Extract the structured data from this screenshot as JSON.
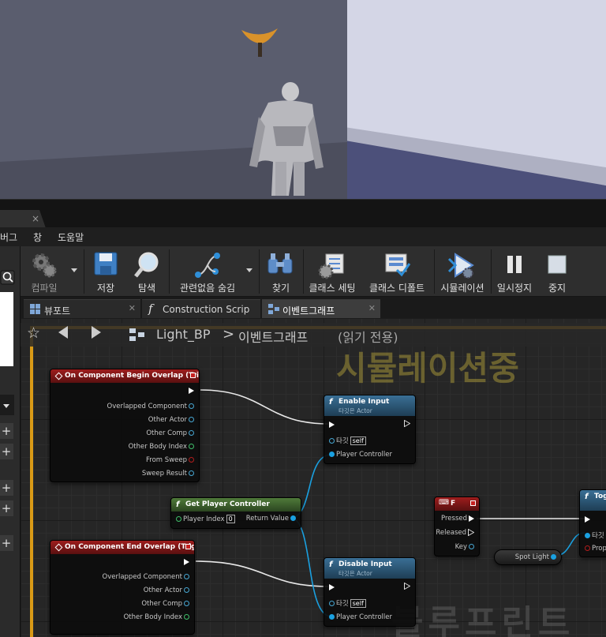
{
  "window": {
    "tab_close": "×"
  },
  "menu": [
    "버그",
    "창",
    "도움말"
  ],
  "toolbar": [
    {
      "label": "컴파일",
      "icon": "compile-icon"
    },
    {
      "label": "저장",
      "icon": "save-icon"
    },
    {
      "label": "탐색",
      "icon": "browse-icon"
    },
    {
      "label": "관련없음 숨김",
      "icon": "hide-unrelated-icon"
    },
    {
      "label": "찾기",
      "icon": "find-icon"
    },
    {
      "label": "클래스 세팅",
      "icon": "class-settings-icon"
    },
    {
      "label": "클래스 디폴트",
      "icon": "class-defaults-icon"
    },
    {
      "label": "시뮬레이션",
      "icon": "simulation-icon"
    },
    {
      "label": "일시정지",
      "icon": "pause-icon"
    },
    {
      "label": "중지",
      "icon": "stop-icon"
    }
  ],
  "tabs": [
    {
      "label": "뷰포트",
      "icon": "viewport-icon"
    },
    {
      "label": "Construction Scrip",
      "icon": "function-icon"
    },
    {
      "label": "이벤트그래프",
      "icon": "graph-icon"
    }
  ],
  "breadcrumb": {
    "blueprint": "Light_BP",
    "sep": ">",
    "graph": "이벤트그래프",
    "readonly": "(읽기 전용)"
  },
  "watermarks": {
    "simulating": "시뮬레이션중",
    "blueprint": "블루프린트"
  },
  "nodes": {
    "begin_overlap": {
      "title": "On Component Begin Overlap (Trigger)",
      "pins": [
        "Overlapped Component",
        "Other Actor",
        "Other Comp",
        "Other Body Index",
        "From Sweep",
        "Sweep Result"
      ]
    },
    "end_overlap": {
      "title": "On Component End Overlap (Trigger)",
      "pins": [
        "Overlapped Component",
        "Other Actor",
        "Other Comp",
        "Other Body Index"
      ]
    },
    "enable_input": {
      "title": "Enable Input",
      "subtitle": "타깃은 Actor",
      "target_label": "타깃",
      "target_value": "self",
      "pc_label": "Player Controller"
    },
    "disable_input": {
      "title": "Disable Input",
      "subtitle": "타깃은 Actor",
      "target_label": "타깃",
      "target_value": "self",
      "pc_label": "Player Controller"
    },
    "get_pc": {
      "title": "Get Player Controller",
      "index_label": "Player Index",
      "index_value": "0",
      "return_label": "Return Value"
    },
    "key_f": {
      "title": "F",
      "pressed": "Pressed",
      "released": "Released",
      "key": "Key"
    },
    "spotlight": {
      "title": "Spot Light"
    },
    "toggle": {
      "title": "Tog",
      "target": "타깃",
      "prop": "Prop"
    }
  }
}
